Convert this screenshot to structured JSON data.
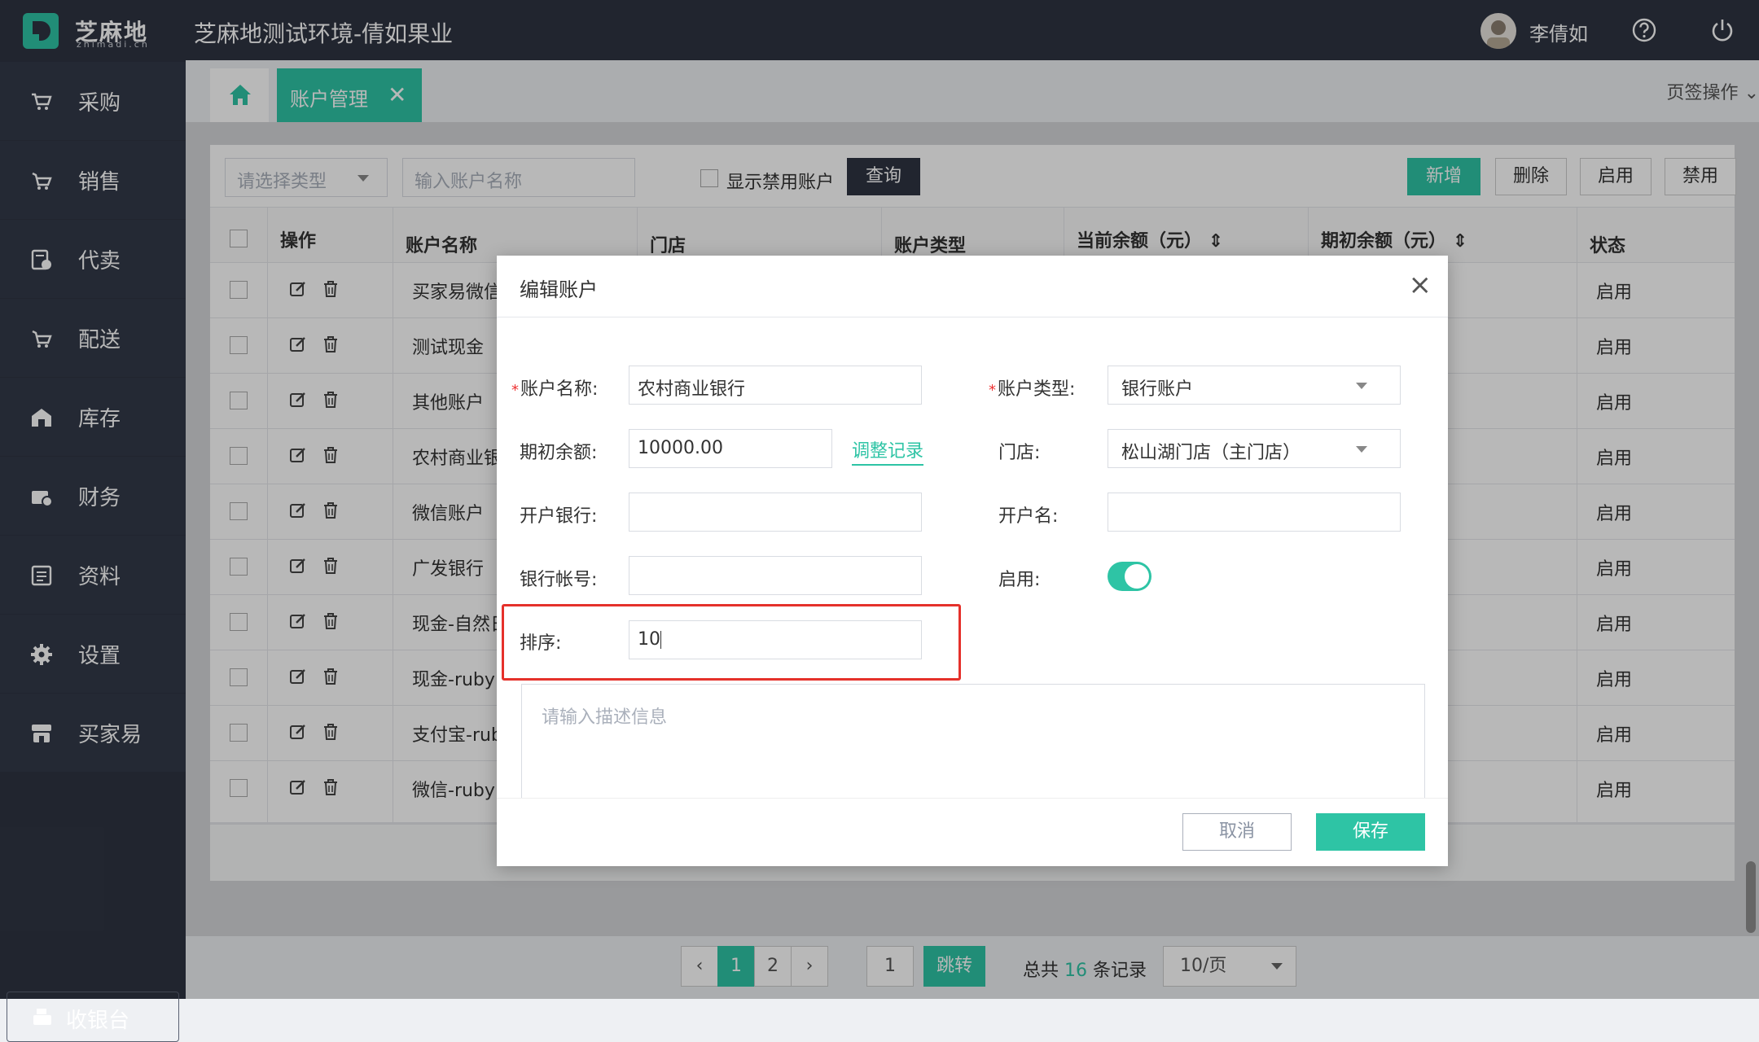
{
  "header": {
    "logo_text": "芝麻地",
    "logo_sub": "zhimadi.cn",
    "app_title": "芝麻地测试环境-倩如果业",
    "user_name": "李倩如",
    "help_icon": "help-circle-icon",
    "power_icon": "power-icon",
    "accent": "#2ec4a5",
    "bg": "#2f3442"
  },
  "sidebar": {
    "items": [
      {
        "label": "采购",
        "icon": "cart-icon"
      },
      {
        "label": "销售",
        "icon": "sales-cart-icon"
      },
      {
        "label": "代卖",
        "icon": "consign-icon"
      },
      {
        "label": "配送",
        "icon": "delivery-icon"
      },
      {
        "label": "库存",
        "icon": "warehouse-icon"
      },
      {
        "label": "财务",
        "icon": "finance-icon"
      },
      {
        "label": "资料",
        "icon": "document-icon"
      },
      {
        "label": "设置",
        "icon": "gear-icon"
      },
      {
        "label": "买家易",
        "icon": "store-icon"
      }
    ],
    "cashier": "收银台"
  },
  "tabs": {
    "active_label": "账户管理",
    "ops": "页签操作"
  },
  "toolbar": {
    "type_placeholder": "请选择类型",
    "name_placeholder": "输入账户名称",
    "show_disabled": "显示禁用账户",
    "query": "查询",
    "add": "新增",
    "delete": "删除",
    "enable": "启用",
    "disable": "禁用"
  },
  "table": {
    "headers": [
      "操作",
      "账户名称",
      "门店",
      "账户类型",
      "当前余额（元）",
      "期初余额（元）",
      "状态"
    ],
    "rows": [
      {
        "name": "买家易微信",
        "status": "启用"
      },
      {
        "name": "测试现金",
        "status": "启用"
      },
      {
        "name": "其他账户",
        "status": "启用"
      },
      {
        "name": "农村商业银",
        "status": "启用"
      },
      {
        "name": "微信账户",
        "status": "启用"
      },
      {
        "name": "广发银行",
        "status": "启用"
      },
      {
        "name": "现金-自然日",
        "status": "启用"
      },
      {
        "name": "现金-ruby",
        "status": "启用"
      },
      {
        "name": "支付宝-ruby",
        "status": "启用"
      },
      {
        "name": "微信-ruby",
        "status": "启用"
      }
    ]
  },
  "pager": {
    "pages": [
      "1",
      "2"
    ],
    "jump_value": "1",
    "jump": "跳转",
    "total_prefix": "总共",
    "total": "16",
    "total_suffix": "条记录",
    "page_size": "10/页"
  },
  "modal": {
    "title": "编辑账户",
    "name_label": "账户名称:",
    "name_value": "农村商业银行",
    "type_label": "账户类型:",
    "type_value": "银行账户",
    "init_label": "期初余额:",
    "init_value": "10000.00",
    "adjust_link": "调整记录",
    "shop_label": "门店:",
    "shop_value": "松山湖门店（主门店）",
    "bank_label": "开户银行:",
    "holder_label": "开户名:",
    "account_label": "银行帐号:",
    "enable_label": "启用:",
    "enabled": true,
    "sort_label": "排序:",
    "sort_value": "10",
    "desc_placeholder": "请输入描述信息",
    "cancel": "取消",
    "save": "保存"
  }
}
